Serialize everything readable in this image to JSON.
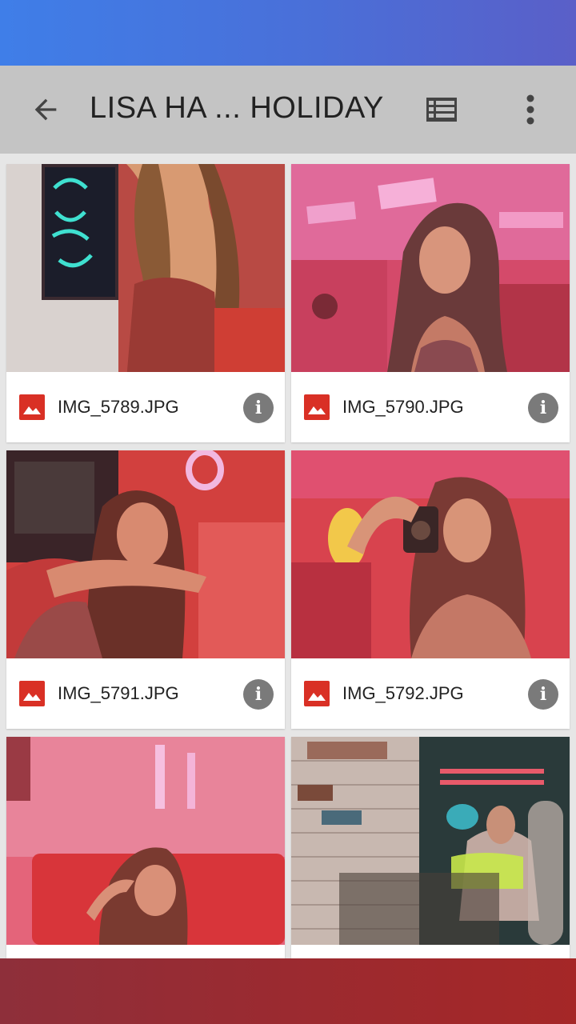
{
  "toolbar": {
    "title": "LISA HA ... HOLIDAY",
    "back_icon": "arrow-back-icon",
    "view_icon": "list-view-icon",
    "more_icon": "more-vert-icon"
  },
  "files": [
    {
      "name": "IMG_5789.JPG",
      "file_icon": "image-file-icon",
      "info_icon": "info-icon"
    },
    {
      "name": "IMG_5790.JPG",
      "file_icon": "image-file-icon",
      "info_icon": "info-icon"
    },
    {
      "name": "IMG_5791.JPG",
      "file_icon": "image-file-icon",
      "info_icon": "info-icon"
    },
    {
      "name": "IMG_5792.JPG",
      "file_icon": "image-file-icon",
      "info_icon": "info-icon"
    },
    {
      "name": "",
      "file_icon": "image-file-icon",
      "info_icon": "info-icon"
    },
    {
      "name": "",
      "file_icon": "image-file-icon",
      "info_icon": "info-icon"
    }
  ],
  "info_glyph": "i",
  "colors": {
    "status_bar": "#4a6fd8",
    "app_bar": "#c4c4c4",
    "image_icon": "#d93025",
    "info_button": "#7a7a7a",
    "nav_bar": "#9b2a30"
  }
}
